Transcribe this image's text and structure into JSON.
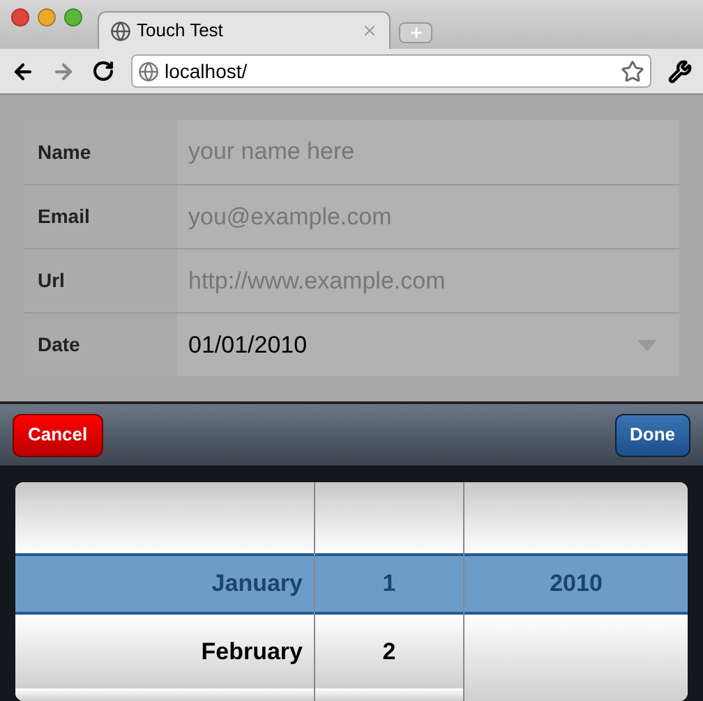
{
  "browser": {
    "tab": {
      "title": "Touch Test",
      "selected": true
    },
    "nav": {
      "back_disabled": false,
      "forward_disabled": true
    },
    "address": "localhost/"
  },
  "form": {
    "rows": [
      {
        "label": "Name",
        "kind": "text",
        "placeholder": "your name here"
      },
      {
        "label": "Email",
        "kind": "text",
        "placeholder": "you@example.com"
      },
      {
        "label": "Url",
        "kind": "text",
        "placeholder": "http://www.example.com"
      },
      {
        "label": "Date",
        "kind": "select",
        "value": "01/01/2010"
      }
    ]
  },
  "picker": {
    "cancel": "Cancel",
    "done": "Done",
    "columns": [
      {
        "items": [
          {
            "label": "January",
            "selected": true
          },
          {
            "label": "February",
            "selected": false
          }
        ]
      },
      {
        "items": [
          {
            "label": "1",
            "selected": true
          },
          {
            "label": "2",
            "selected": false
          }
        ]
      },
      {
        "items": [
          {
            "label": "2010",
            "selected": true
          }
        ]
      }
    ]
  }
}
